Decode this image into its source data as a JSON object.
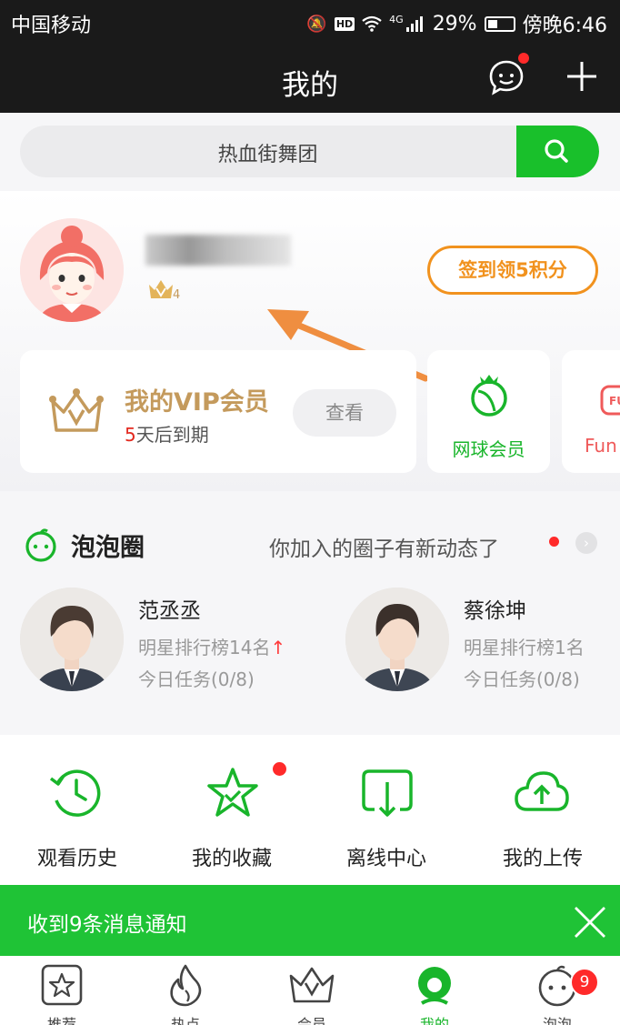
{
  "status_bar": {
    "carrier": "中国移动",
    "network": "4G",
    "hd": "HD",
    "battery": "29%",
    "time": "傍晚6:46"
  },
  "header": {
    "title": "我的"
  },
  "search": {
    "placeholder": "热血街舞团"
  },
  "profile": {
    "level": "4",
    "signin_label": "签到领5积分"
  },
  "vip": {
    "title": "我的VIP会员",
    "days": "5",
    "expiry_suffix": "天后到期",
    "view_label": "查看"
  },
  "memberships": [
    {
      "label": "网球会员"
    },
    {
      "label": "Fun"
    }
  ],
  "bubble_circle": {
    "title": "泡泡圈",
    "note": "你加入的圈子有新动态了"
  },
  "stars": [
    {
      "name": "范丞丞",
      "rank": "明星排行榜14名",
      "rank_trend": "↑",
      "task": "今日任务(0/8)"
    },
    {
      "name": "蔡徐坤",
      "rank": "明星排行榜1名",
      "task": "今日任务(0/8)"
    }
  ],
  "shortcuts": [
    {
      "label": "观看历史",
      "icon": "history-icon"
    },
    {
      "label": "我的收藏",
      "icon": "favorite-star-icon"
    },
    {
      "label": "离线中心",
      "icon": "download-icon"
    },
    {
      "label": "我的上传",
      "icon": "upload-cloud-icon"
    }
  ],
  "notice": {
    "text": "收到9条消息通知"
  },
  "tabbar": {
    "tabs": [
      {
        "label": "推荐",
        "icon": "recommend-star-icon"
      },
      {
        "label": "热点",
        "icon": "hot-flame-icon"
      },
      {
        "label": "会员",
        "icon": "member-crown-icon"
      },
      {
        "label": "我的",
        "icon": "profile-icon",
        "active": true
      },
      {
        "label": "泡泡",
        "icon": "bubble-icon"
      }
    ],
    "bubble_badge": "9"
  },
  "colors": {
    "brand_green": "#19c02b",
    "accent_orange": "#f1921e",
    "vip_gold": "#c49a5c",
    "alert_red": "#ff2a2a",
    "header_bg": "#1a1a1a"
  }
}
